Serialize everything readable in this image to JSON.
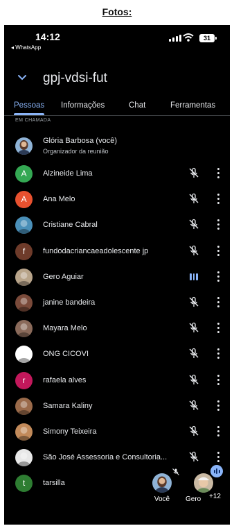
{
  "caption": "Fotos:",
  "status_bar": {
    "time": "14:12",
    "back_app": "◂ WhatsApp",
    "battery": "31"
  },
  "meeting": {
    "code": "gpj-vdsi-fut"
  },
  "tabs": [
    "Pessoas",
    "Informações",
    "Chat",
    "Ferramentas"
  ],
  "section_label": "EM CHAMADA",
  "host": {
    "name": "Glória Barbosa (você)",
    "role": "Organizador da reunião",
    "avatar": "photo",
    "color": "#6d8fb0"
  },
  "participants": [
    {
      "name": "Alzineide Lima",
      "initial": "A",
      "color": "#34a853",
      "mic": "muted"
    },
    {
      "name": "Ana Melo",
      "initial": "A",
      "color": "#e8512f",
      "mic": "muted"
    },
    {
      "name": "Cristiane Cabral",
      "initial": "",
      "color": "#4a8fb8",
      "mic": "muted"
    },
    {
      "name": "fundodacriancaeadolescente jp",
      "initial": "f",
      "color": "#6e3b2a",
      "mic": "muted"
    },
    {
      "name": "Gero Aguiar",
      "initial": "",
      "color": "#b8a48a",
      "mic": "speaking"
    },
    {
      "name": "janine bandeira",
      "initial": "",
      "color": "#7a4a3a",
      "mic": "muted"
    },
    {
      "name": "Mayara Melo",
      "initial": "",
      "color": "#8a6a5a",
      "mic": "muted"
    },
    {
      "name": "ONG CICOVI",
      "initial": "",
      "color": "#ffffff",
      "mic": "muted"
    },
    {
      "name": "rafaela alves",
      "initial": "r",
      "color": "#c2185b",
      "mic": "muted"
    },
    {
      "name": "Samara Kaliny",
      "initial": "",
      "color": "#9a6a4a",
      "mic": "muted"
    },
    {
      "name": "Simony Teixeira",
      "initial": "",
      "color": "#c28a5a",
      "mic": "muted"
    },
    {
      "name": "São José Assessoria e Consultoria...",
      "initial": "",
      "color": "#e8e8e8",
      "mic": "muted"
    },
    {
      "name": "tarsilla",
      "initial": "t",
      "color": "#2e7d32",
      "mic": "none"
    }
  ],
  "tiles": {
    "self_label": "Você",
    "other_label": "Gero",
    "more_count": "+12"
  },
  "colors": {
    "accent": "#8ab4f8",
    "background": "#000000",
    "text": "#e8eaed"
  }
}
